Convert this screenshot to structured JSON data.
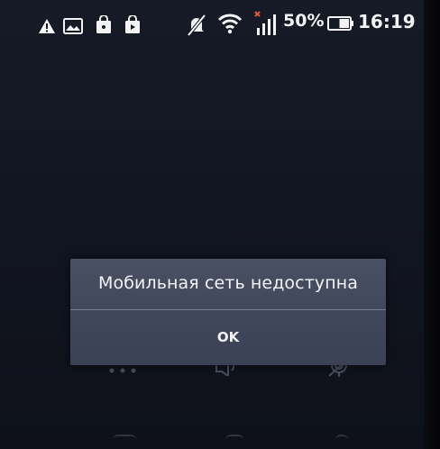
{
  "status_bar": {
    "icons_left": [
      "warning-icon",
      "image-notification-icon",
      "store-bag-icon",
      "store-play-icon"
    ],
    "icons_right": [
      "silent-mode-icon",
      "wifi-icon",
      "no-sim-signal-icon"
    ],
    "battery_percent_label": "50%",
    "battery_level": 0.5,
    "time": "16:19"
  },
  "dialog": {
    "message": "Мобильная сеть недоступна",
    "ok_label": "OK"
  },
  "background_keys": [
    "dialpad-icon",
    "speaker-icon",
    "mute-mic-icon"
  ],
  "colors": {
    "screen_bg": "#141824",
    "dialog_bg": "#444a5d",
    "divider": "#8d93a6",
    "text": "#f2f3f7",
    "signal_off": "#e05a3c"
  }
}
